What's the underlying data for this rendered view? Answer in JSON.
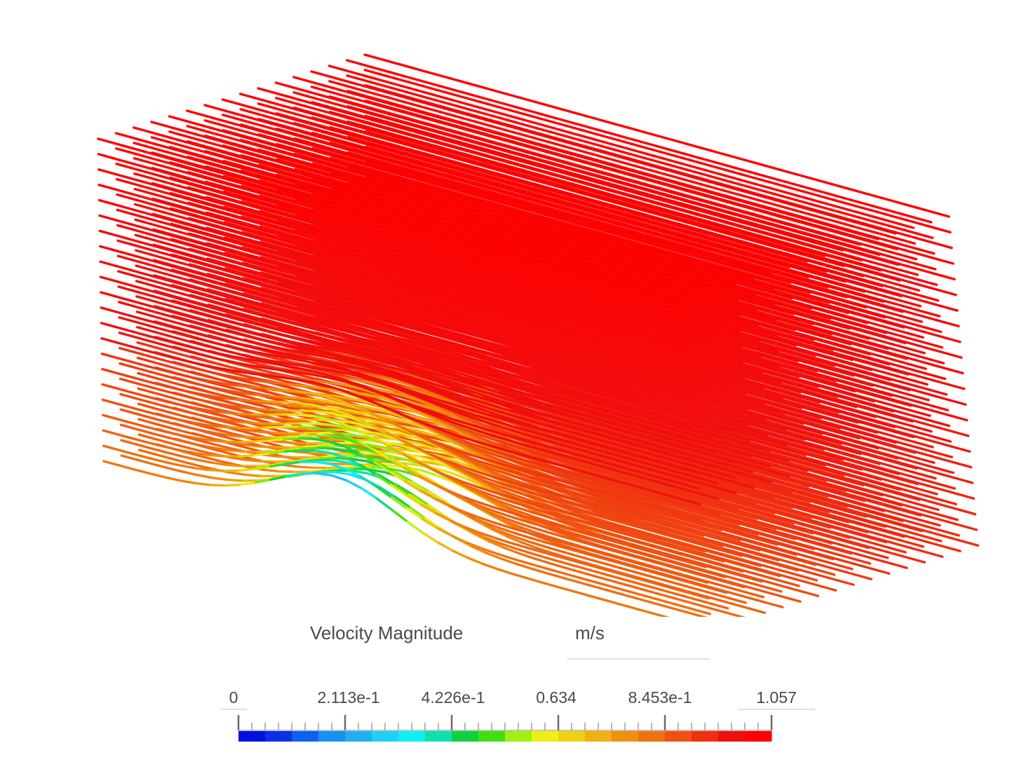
{
  "viewer": {
    "icon": "streamlines-3d-view"
  },
  "legend": {
    "title": "Velocity Magnitude",
    "unit": "m/s",
    "min": 0,
    "max": 1.057,
    "tick_labels": [
      "0",
      "2.113e-1",
      "4.226e-1",
      "0.634",
      "8.453e-1",
      "1.057"
    ],
    "tick_values": [
      0,
      0.2113,
      0.4226,
      0.634,
      0.8453,
      1.057
    ],
    "color_stops": [
      "#0010e0",
      "#0a30e8",
      "#1060ee",
      "#1890f0",
      "#20b0f2",
      "#20d0f4",
      "#10f0f4",
      "#10e0b0",
      "#10d040",
      "#40e010",
      "#a0f010",
      "#f0f010",
      "#f0d010",
      "#f0b010",
      "#f09010",
      "#f07010",
      "#f05010",
      "#f03010",
      "#f01010",
      "#ff0000"
    ],
    "colormap": "blue-cyan-green-yellow-red"
  }
}
